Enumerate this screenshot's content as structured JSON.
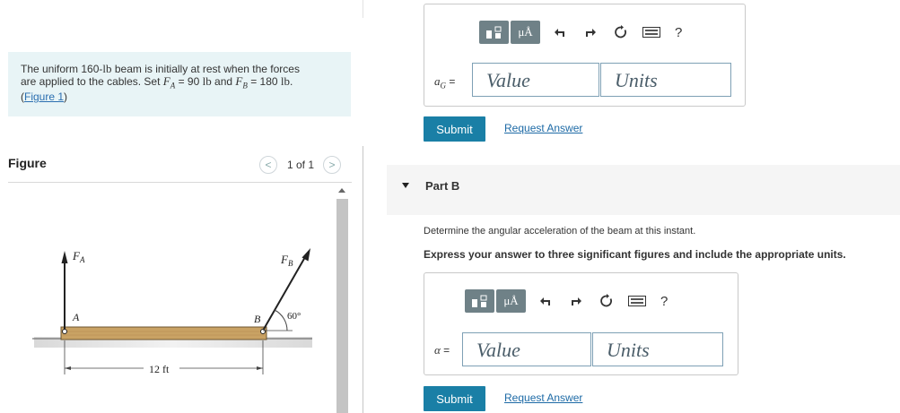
{
  "problem": {
    "line1": "The uniform 160-",
    "lb1": "lb",
    "line1b": " beam is initially at rest when the forces",
    "line2a": "are applied to the cables. Set ",
    "fa": "F",
    "fa_sub": "A",
    "line2b": " = 90 ",
    "lb2": "lb",
    "line2c": " and ",
    "fb": "F",
    "fb_sub": "B",
    "line2d": " = 180 ",
    "lb3": "lb",
    "line2e": ".",
    "paren_open": "(",
    "figure_link": "Figure 1",
    "paren_close": ")"
  },
  "figure_panel": {
    "label": "Figure",
    "pager": "1 of 1",
    "prev": "<",
    "next": ">"
  },
  "figure": {
    "fa_label": "F",
    "fa_sub": "A",
    "fb_label": "F",
    "fb_sub": "B",
    "point_a": "A",
    "point_b": "B",
    "angle": "60°",
    "length": "12 ft"
  },
  "part_a": {
    "var": "a",
    "var_sub": "G",
    "eq": " =",
    "value_placeholder": "Value",
    "units_placeholder": "Units",
    "submit": "Submit",
    "request": "Request Answer"
  },
  "part_b": {
    "title": "Part B",
    "prompt": "Determine the angular acceleration of the beam at this instant.",
    "instruction": "Express your answer to three significant figures and include the appropriate units.",
    "var": "α",
    "eq": " =",
    "value_placeholder": "Value",
    "units_placeholder": "Units",
    "submit": "Submit",
    "request": "Request Answer"
  },
  "toolbar": {
    "mu_label": "μÅ",
    "help": "?",
    "icons": [
      "templates-icon",
      "undo-icon",
      "redo-icon",
      "reset-icon",
      "keyboard-icon",
      "help-icon"
    ]
  },
  "colors": {
    "accent": "#1a7fa6",
    "toolbar_btn": "#6f8187",
    "problem_bg": "#e8f4f6",
    "beam": "#c9a264"
  }
}
